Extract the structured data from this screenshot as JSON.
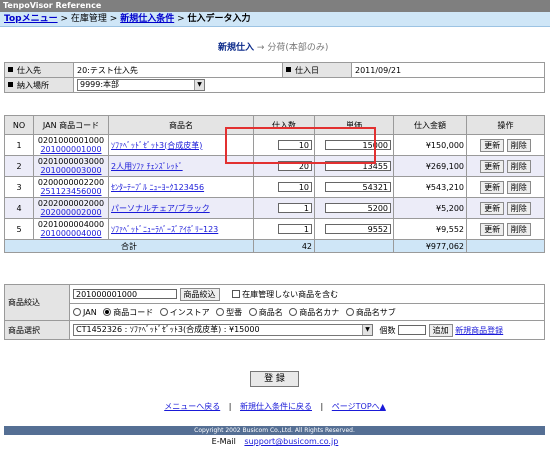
{
  "app_title": "TenpoVisor Reference",
  "breadcrumb": {
    "items": [
      "Topメニュー",
      "在庫管理",
      "新規仕入条件",
      "仕入データ入力"
    ],
    "separator": ">"
  },
  "steps": {
    "current": "新規仕入",
    "arrow": "→",
    "next": "分荷(本部のみ)"
  },
  "info": {
    "supplier_label": "仕入先",
    "supplier_value": "20:テスト仕入先",
    "date_label": "仕入日",
    "date_value": "2011/09/21",
    "location_label": "納入場所",
    "location_value": "9999:本部"
  },
  "grid": {
    "headers": [
      "NO",
      "JAN 商品コード",
      "商品名",
      "仕入数",
      "単価",
      "仕入金額",
      "操作"
    ],
    "update_label": "更新",
    "delete_label": "削除",
    "rows": [
      {
        "no": "1",
        "jan": "0201000001000",
        "code": "201000001000",
        "name": "ｿﾌｧﾍﾞｯﾄﾞｾﾞｯﾄ3(合成皮革)",
        "qty": "10",
        "price": "15000",
        "amount": "¥150,000"
      },
      {
        "no": "2",
        "jan": "0201000003000",
        "code": "201000003000",
        "name": "2人用ｿﾌｧ ﾁｪﾝｽﾞﾚｯﾄﾞ",
        "qty": "20",
        "price": "13455",
        "amount": "¥269,100"
      },
      {
        "no": "3",
        "jan": "0200000002200",
        "code": "251123456000",
        "name": "ｾﾝﾀｰﾃｰﾌﾞﾙ ﾆｭｰﾖｰｸ123456",
        "qty": "10",
        "price": "54321",
        "amount": "¥543,210"
      },
      {
        "no": "4",
        "jan": "0202000002000",
        "code": "202000002000",
        "name": "パーソナルチェア/ブラック",
        "qty": "1",
        "price": "5200",
        "amount": "¥5,200"
      },
      {
        "no": "5",
        "jan": "0201000004000",
        "code": "201000004000",
        "name": "ｿﾌｧﾍﾞｯﾄﾞﾆｭｰﾗﾊﾞｰｽﾞｱｲﾎﾞﾘｰ123",
        "qty": "1",
        "price": "9552",
        "amount": "¥9,552"
      }
    ],
    "total_label": "合計",
    "total_qty": "42",
    "total_amount": "¥977,062"
  },
  "filter": {
    "narrow_label": "商品絞込",
    "narrow_value": "201000001000",
    "narrow_button": "商品絞込",
    "check_label": "在庫管理しない商品を含む",
    "radios": [
      "JAN",
      "商品コード",
      "インストア",
      "型番",
      "商品名",
      "商品名カナ",
      "商品名サブ"
    ],
    "radio_selected": 1,
    "select_label": "商品選択",
    "select_value": "CT1452326 : ｿﾌｧﾍﾞｯﾄﾞｾﾞｯﾄ3(合成皮革) : ¥15000",
    "count_label": "個数",
    "add_button": "追加",
    "new_product_link": "新規商品登録"
  },
  "register_button": "登 録",
  "links": {
    "menu": "メニューへ戻る",
    "separator": "|",
    "new_condition": "新規仕入条件に戻る",
    "page_top": "ページTOPへ▲"
  },
  "footer": {
    "copyright": "Copyright 2002 Busicom Co.,Ltd. All Rights Reserved.",
    "email_label": "E-Mail",
    "email": "support@busicom.co.jp"
  },
  "colors": {
    "breadcrumb_bg": "#cfe6f7",
    "title_bar": "#7f7f7f",
    "footer_bar": "#556f94",
    "highlight_box": "#e23030"
  }
}
